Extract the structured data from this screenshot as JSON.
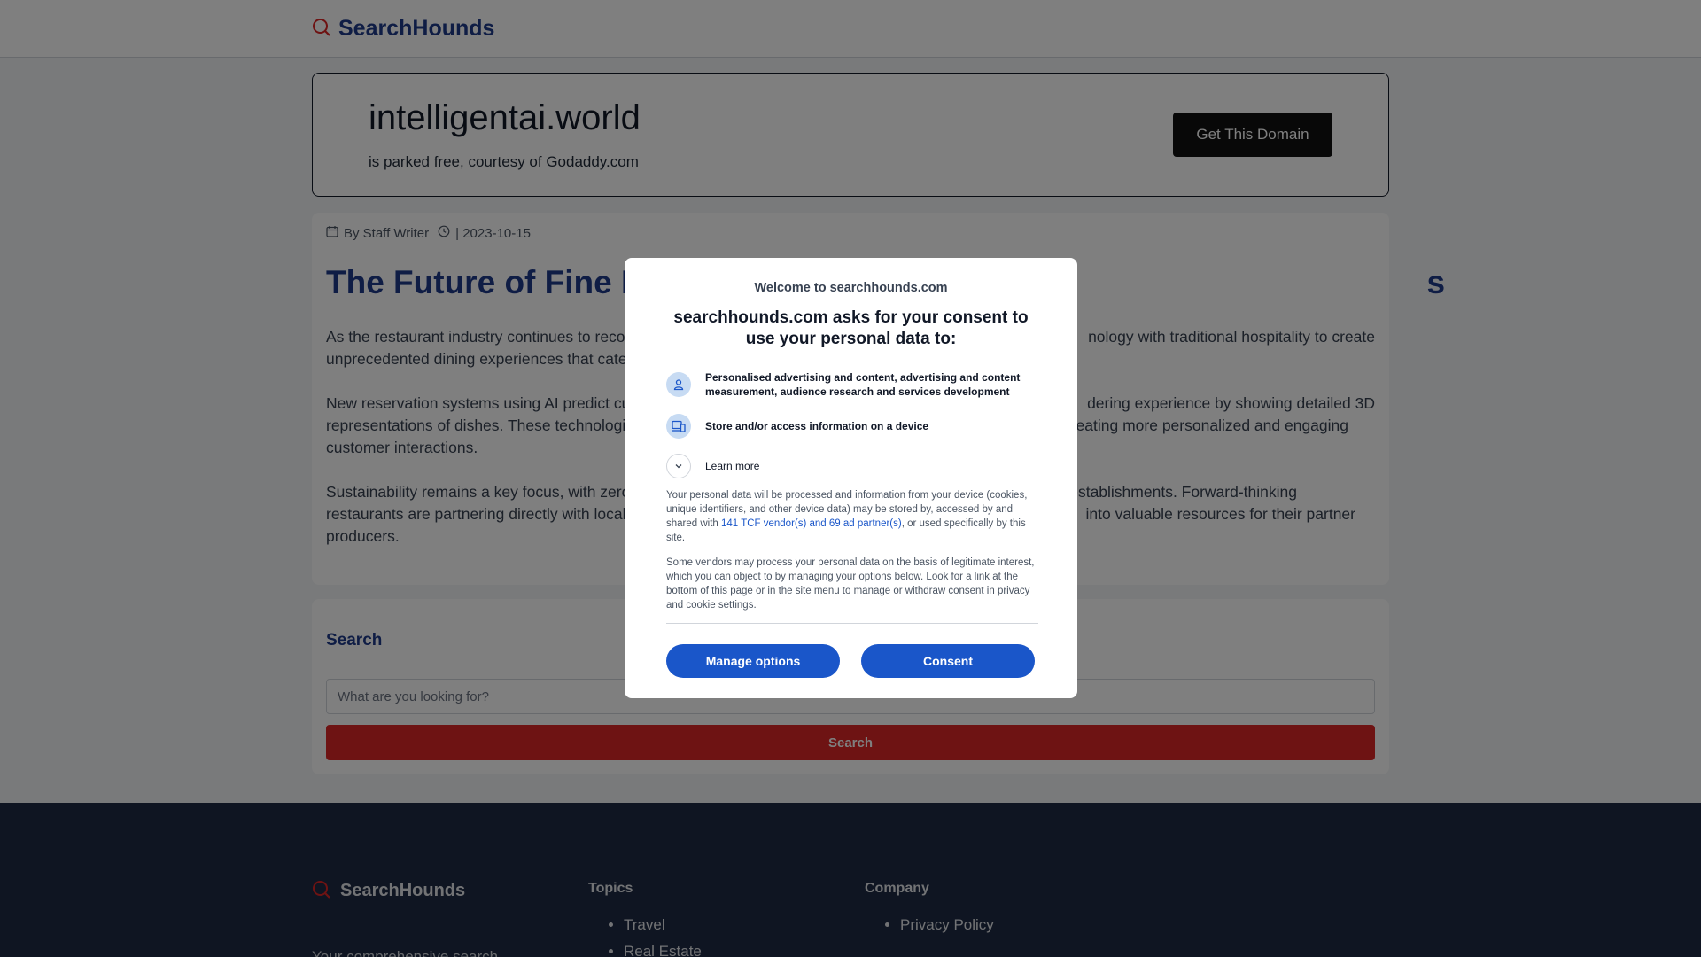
{
  "header": {
    "brand": "SearchHounds"
  },
  "domain_banner": {
    "domain": "intelligentai.world",
    "subtitle": "is parked free, courtesy of Godaddy.com",
    "cta_label": "Get This Domain"
  },
  "article": {
    "author": "By Staff Writer",
    "date": "| 2023-10-15",
    "title_visible_left": "The Future of Fine Di",
    "title_visible_right": "s",
    "paragraphs": [
      {
        "left": "As the restaurant industry continues to reco",
        "right": "nology with traditional hospitality to create",
        "line2": "unprecedented dining experiences that cater"
      },
      {
        "left": "New reservation systems using AI predict cus",
        "right": "dering experience by showing detailed 3D",
        "line2_left": "representations of dishes. These technologic",
        "line2_right": "reating more personalized and engaging",
        "line3": "customer interactions."
      },
      {
        "left": "Sustainability remains a key focus, with zero-",
        "right": "establishments. Forward-thinking",
        "line2_left": "restaurants are partnering directly with local",
        "line2_right": "into valuable resources for their partner",
        "line3": "producers."
      }
    ]
  },
  "search": {
    "heading": "Search",
    "placeholder": "What are you looking for?",
    "button": "Search"
  },
  "footer": {
    "brand": "SearchHounds",
    "tagline": "Your comprehensive search",
    "topics_title": "Topics",
    "topics": [
      "Travel",
      "Real Estate"
    ],
    "company_title": "Company",
    "company_links": [
      "Privacy Policy"
    ]
  },
  "consent": {
    "welcome": "Welcome to searchhounds.com",
    "title": "searchhounds.com asks for your consent to use your personal data to:",
    "purposes": [
      {
        "icon": "person-icon",
        "text": "Personalised advertising and content, advertising and content measurement, audience research and services development"
      },
      {
        "icon": "device-icon",
        "text": "Store and/or access information on a device"
      }
    ],
    "learn_more": "Learn more",
    "info_before_link": "Your personal data will be processed and information from your device (cookies, unique identifiers, and other device data) may be stored by, accessed by and shared with ",
    "info_link": "141 TCF vendor(s) and 69 ad partner(s)",
    "info_after_link": ", or used specifically by this site.",
    "legit_interest": "Some vendors may process your personal data on the basis of legitimate interest, which you can object to by managing your options below. Look for a link at the bottom of this page or in the site menu to manage or withdraw consent in privacy and cookie settings.",
    "manage_label": "Manage options",
    "consent_label": "Consent",
    "accent": "#1a56c9"
  }
}
